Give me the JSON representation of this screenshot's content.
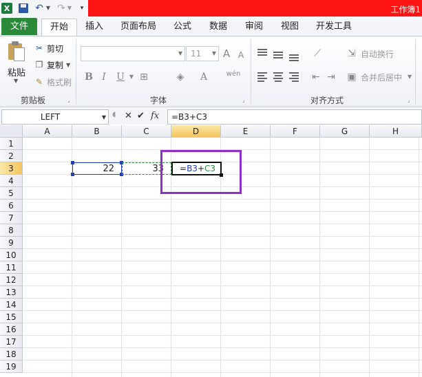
{
  "window": {
    "title": "工作簿1",
    "logo_letter": "X"
  },
  "tabs": [
    {
      "label": "文件"
    },
    {
      "label": "开始"
    },
    {
      "label": "插入"
    },
    {
      "label": "页面布局"
    },
    {
      "label": "公式"
    },
    {
      "label": "数据"
    },
    {
      "label": "审阅"
    },
    {
      "label": "视图"
    },
    {
      "label": "开发工具"
    }
  ],
  "ribbon": {
    "clipboard": {
      "label": "剪贴板",
      "paste": "粘贴",
      "cut": "剪切",
      "copy": "复制",
      "format_painter": "格式刷"
    },
    "font": {
      "label": "字体",
      "size": "11",
      "bold": "B",
      "italic": "I",
      "underline": "U",
      "grow": "A",
      "shrink": "A",
      "font_color": "A",
      "phonetic": "wén"
    },
    "alignment": {
      "label": "对齐方式",
      "wrap": "自动换行",
      "merge": "合并后居中"
    }
  },
  "formula_bar": {
    "name_box": "LEFT",
    "fx": "fx",
    "formula": "=B3+C3"
  },
  "sheet": {
    "columns": [
      "A",
      "B",
      "C",
      "D",
      "E",
      "F",
      "G",
      "H"
    ],
    "rows": [
      "1",
      "2",
      "3",
      "4",
      "5",
      "6",
      "7",
      "8",
      "9",
      "10",
      "11",
      "12",
      "13",
      "14",
      "15",
      "16",
      "17",
      "18",
      "19"
    ],
    "selected_column": "D",
    "selected_row": "3",
    "cells": {
      "B3": "22",
      "C3": "33",
      "D3_eq": "=",
      "D3_ref1": "B3",
      "D3_plus": "+",
      "D3_ref2": "C3"
    }
  },
  "colors": {
    "accent_red": "#ff1414",
    "file_tab": "#2a8a3a",
    "highlight": "#8e2fc7",
    "ref_blue": "#1f3fb8",
    "ref_green": "#2a8a3a"
  }
}
